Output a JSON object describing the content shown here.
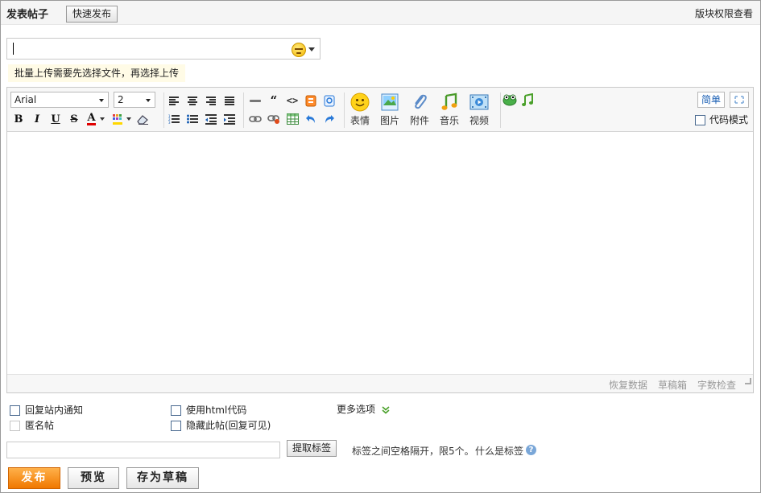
{
  "header": {
    "title": "发表帖子",
    "quick_post": "快速发布",
    "permission_link": "版块权限查看"
  },
  "subject": {
    "value": ""
  },
  "upload_tip": "批量上传需要先选择文件，再选择上传",
  "toolbar": {
    "font_family": "Arial",
    "font_size": "2",
    "bold": "B",
    "italic": "I",
    "underline": "U",
    "strike": "S",
    "font_color": "A",
    "quote": "“",
    "code": "<>",
    "emoticon_label": "表情",
    "image_label": "图片",
    "attachment_label": "附件",
    "music_label": "音乐",
    "video_label": "视频",
    "simple_mode": "简单",
    "code_mode": "代码模式"
  },
  "status_bar": {
    "restore": "恢复数据",
    "drafts": "草稿箱",
    "word_check": "字数检查"
  },
  "options": {
    "reply_notify": "回复站内通知",
    "use_html": "使用html代码",
    "more_options": "更多选项",
    "anonymous": "匿名帖",
    "hide_post": "隐藏此帖(回复可见)"
  },
  "tags": {
    "value": "",
    "extract_button": "提取标签",
    "hint": "标签之间空格隔开，限5个。",
    "what_is": "什么是标签",
    "help": "?"
  },
  "actions": {
    "submit": "发布",
    "preview": "预览",
    "save_draft": "存为草稿"
  }
}
